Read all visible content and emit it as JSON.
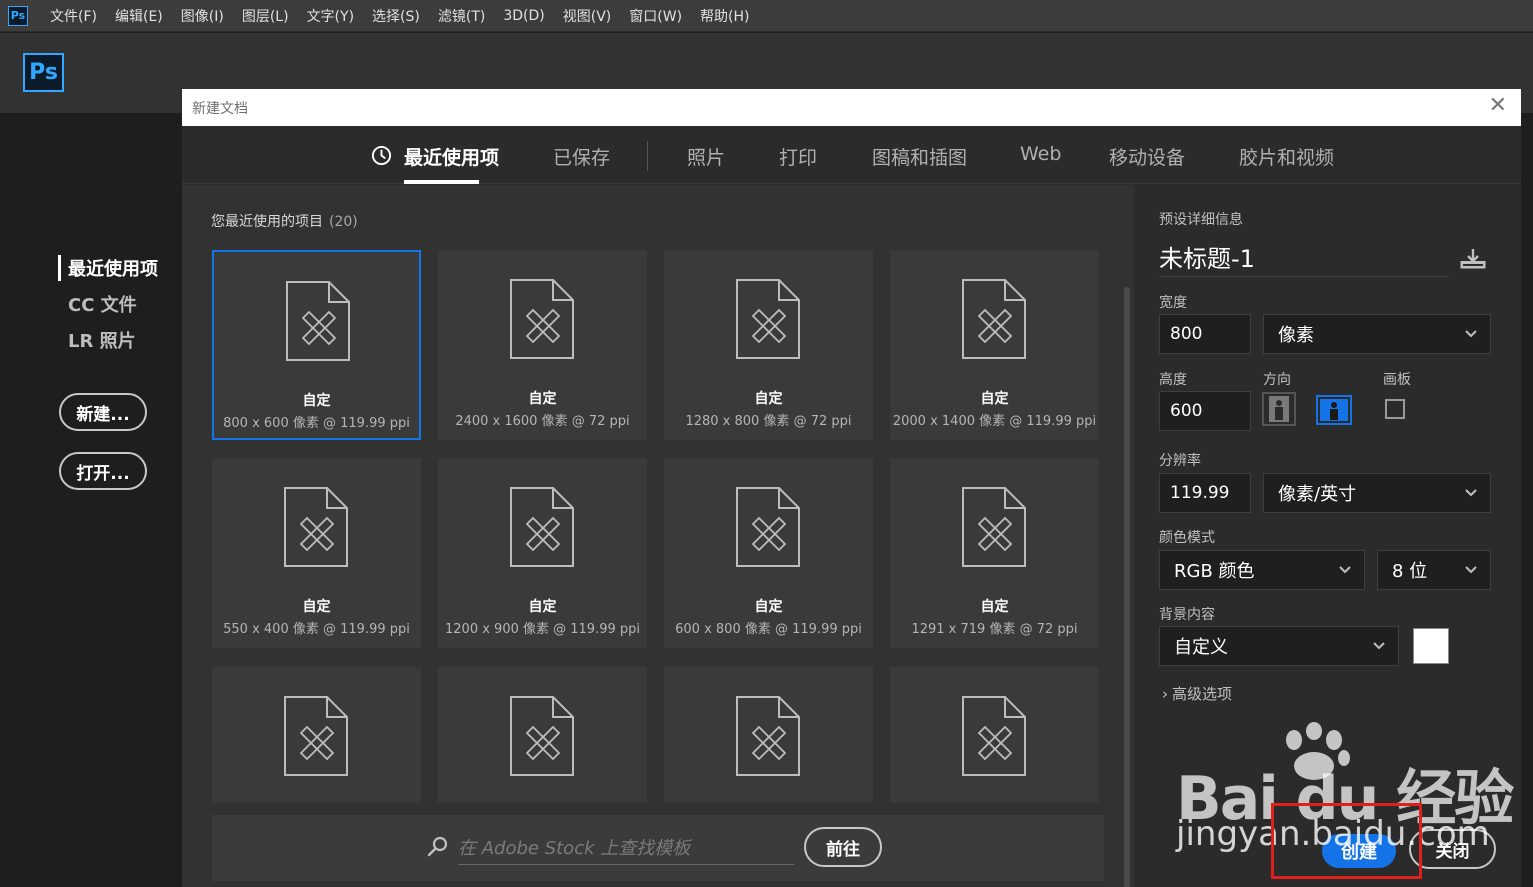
{
  "menubar": {
    "app_icon": "Ps",
    "items": [
      "文件(F)",
      "编辑(E)",
      "图像(I)",
      "图层(L)",
      "文字(Y)",
      "选择(S)",
      "滤镜(T)",
      "3D(D)",
      "视图(V)",
      "窗口(W)",
      "帮助(H)"
    ]
  },
  "home": {
    "logo": "Ps",
    "nav": [
      "最近使用项",
      "CC 文件",
      "LR 照片"
    ],
    "new_button": "新建...",
    "open_button": "打开..."
  },
  "dialog": {
    "title": "新建文档",
    "close_glyph": "✕",
    "tabs": [
      "最近使用项",
      "已保存",
      "照片",
      "打印",
      "图稿和插图",
      "Web",
      "移动设备",
      "胶片和视频"
    ],
    "active_tab": 0,
    "recent_label": "您最近使用的项目",
    "recent_count": "(20)",
    "presets": [
      {
        "name": "自定",
        "desc": "800 x 600 像素 @ 119.99 ppi",
        "selected": true
      },
      {
        "name": "自定",
        "desc": "2400 x 1600 像素 @ 72 ppi"
      },
      {
        "name": "自定",
        "desc": "1280 x 800 像素 @ 72 ppi"
      },
      {
        "name": "自定",
        "desc": "2000 x 1400 像素 @ 119.99 ppi"
      },
      {
        "name": "自定",
        "desc": "550 x 400 像素 @ 119.99 ppi"
      },
      {
        "name": "自定",
        "desc": "1200 x 900 像素 @ 119.99 ppi"
      },
      {
        "name": "自定",
        "desc": "600 x 800 像素 @ 119.99 ppi"
      },
      {
        "name": "自定",
        "desc": "1291 x 719 像素 @ 72 ppi"
      },
      {
        "name": "",
        "desc": ""
      },
      {
        "name": "",
        "desc": ""
      },
      {
        "name": "",
        "desc": ""
      },
      {
        "name": "",
        "desc": ""
      }
    ],
    "stock": {
      "placeholder": "在 Adobe Stock 上查找模板",
      "go_button": "前往"
    },
    "details": {
      "header": "预设详细信息",
      "doc_name": "未标题-1",
      "width_label": "宽度",
      "width_value": "800",
      "width_unit": "像素",
      "height_label": "高度",
      "height_value": "600",
      "orientation_label": "方向",
      "artboard_label": "画板",
      "resolution_label": "分辨率",
      "resolution_value": "119.99",
      "resolution_unit": "像素/英寸",
      "color_mode_label": "颜色模式",
      "color_mode": "RGB 颜色",
      "bit_depth": "8 位",
      "background_label": "背景内容",
      "background": "自定义",
      "background_color": "#ffffff",
      "advanced": "高级选项",
      "create_button": "创建",
      "close_button": "关闭"
    }
  },
  "watermark": {
    "logo_text": "Bai du 经验",
    "url": "jingyan.baidu.com"
  },
  "colors": {
    "accent": "#1473e6",
    "ps_blue": "#31a8ff",
    "highlight_red": "#e0201b"
  }
}
